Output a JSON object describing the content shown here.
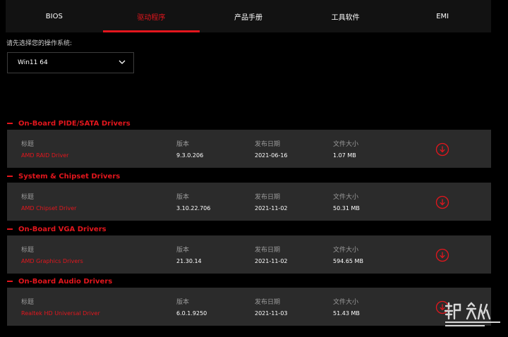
{
  "tabs": [
    {
      "label": "BIOS",
      "active": false
    },
    {
      "label": "驱动程序",
      "active": true
    },
    {
      "label": "产品手册",
      "active": false
    },
    {
      "label": "工具软件",
      "active": false
    },
    {
      "label": "EMI",
      "active": false
    }
  ],
  "os": {
    "label": "请先选择您的操作系统:",
    "selected": "Win11 64"
  },
  "columns": {
    "title": "标题",
    "version": "版本",
    "date": "发布日期",
    "size": "文件大小"
  },
  "sections": [
    {
      "header": "On-Board PIDE/SATA Drivers",
      "name": "AMD RAID Driver",
      "version": "9.3.0.206",
      "date": "2021-06-16",
      "size": "1.07 MB"
    },
    {
      "header": "System & Chipset Drivers",
      "name": "AMD Chipset Driver",
      "version": "3.10.22.706",
      "date": "2021-11-02",
      "size": "50.31 MB"
    },
    {
      "header": "On-Board VGA Drivers",
      "name": "AMD Graphics Drivers",
      "version": "21.30.14",
      "date": "2021-11-02",
      "size": "594.65 MB"
    },
    {
      "header": "On-Board Audio Drivers",
      "name": "Realtek HD Universal Driver",
      "version": "6.0.1.9250",
      "date": "2021-11-03",
      "size": "51.43 MB"
    }
  ],
  "colors": {
    "accent": "#e3161d",
    "row_bg": "#2b2b2b",
    "tab_bg": "#121212"
  },
  "icons": {
    "chevron": "chevron-down-icon",
    "download": "download-icon"
  }
}
